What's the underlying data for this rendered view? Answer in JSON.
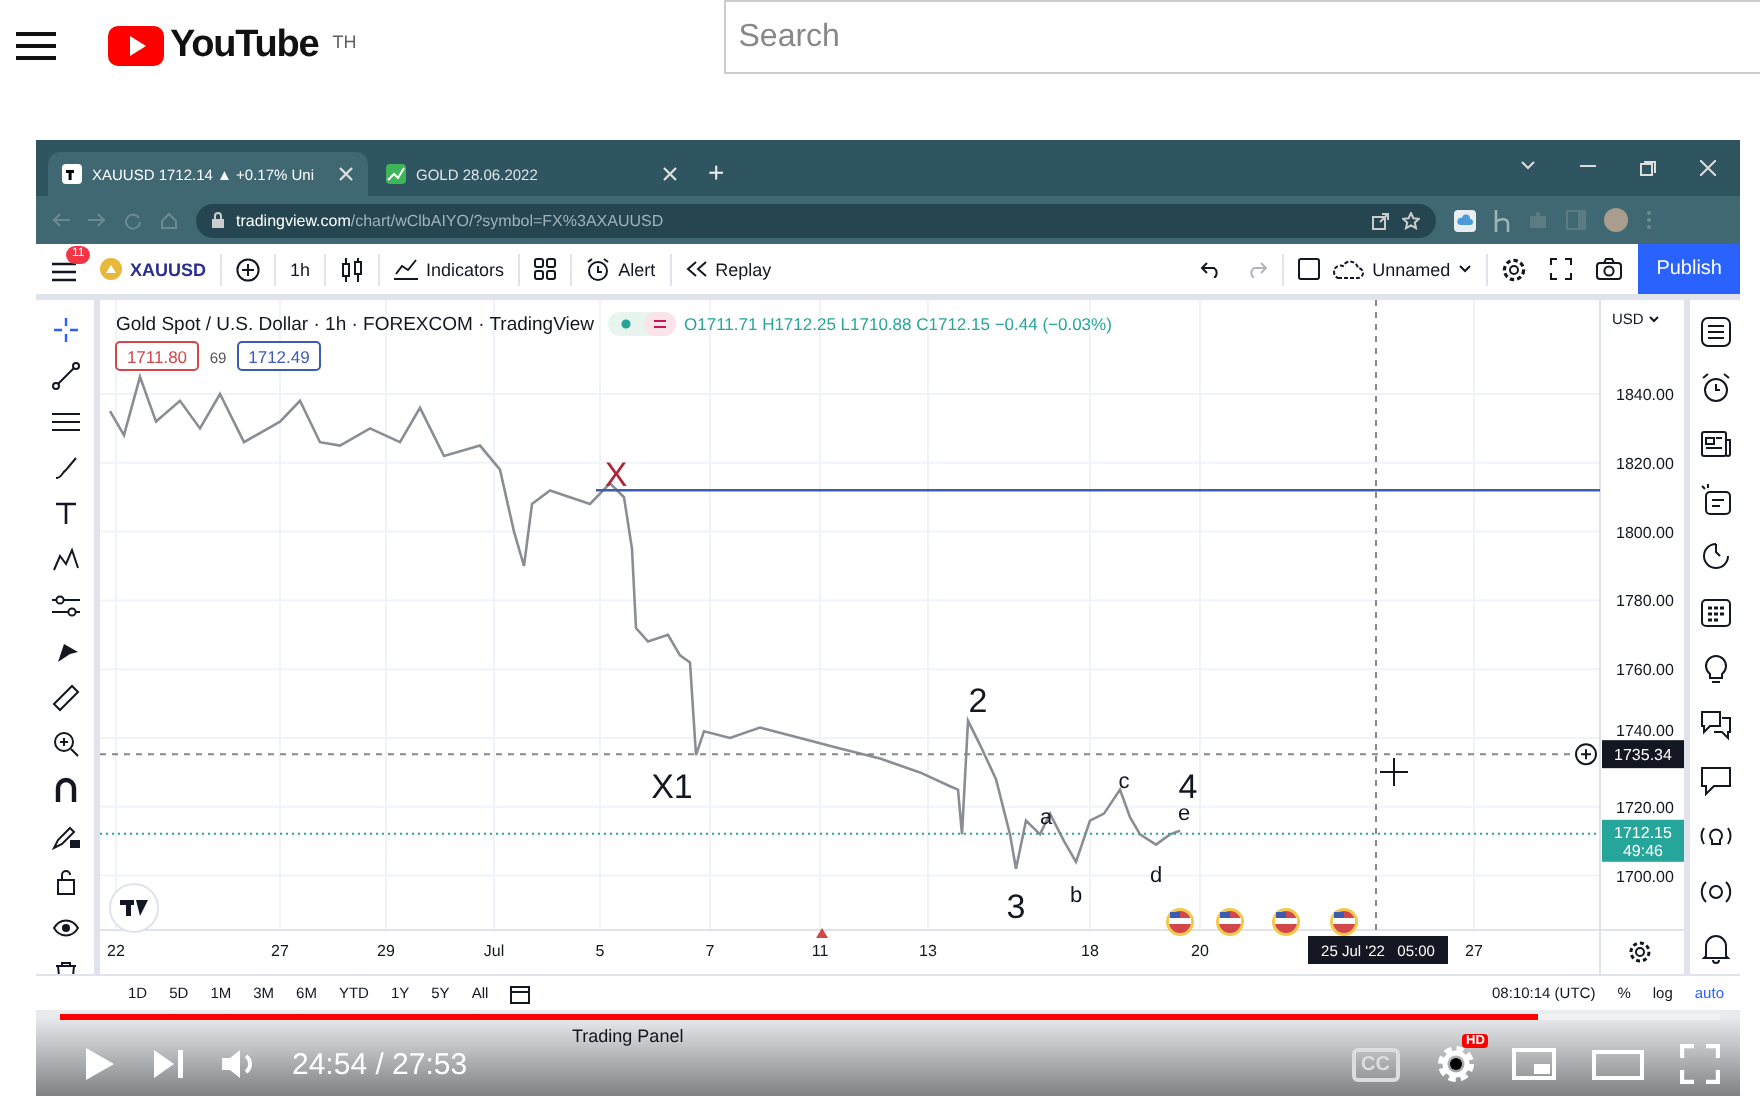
{
  "youtube": {
    "logo": "YouTube",
    "region": "TH",
    "search_placeholder": "Search"
  },
  "browser": {
    "tabs": [
      {
        "title": "XAUUSD 1712.14 ▲ +0.17% Uni",
        "selected": true
      },
      {
        "title": "GOLD 28.06.2022",
        "selected": false
      }
    ],
    "new_tab": "+",
    "address_host": "tradingview.com",
    "address_path": "/chart/wClbAIYO/?symbol=FX%3AXAUUSD"
  },
  "toolbar": {
    "badge": "11",
    "symbol": "XAUUSD",
    "interval": "1h",
    "indicators": "Indicators",
    "alert": "Alert",
    "replay": "Replay",
    "layout": "Unnamed",
    "publish": "Publish"
  },
  "chart": {
    "title": "Gold Spot / U.S. Dollar · 1h · FOREXCOM · TradingView",
    "ohlc": "O1711.71 H1712.25 L1710.88 C1712.15 −0.44 (−0.03%)",
    "bid": "1711.80",
    "spread": "69",
    "ask": "1712.49",
    "currency": "USD",
    "price_labels": [
      "1840.00",
      "1820.00",
      "1800.00",
      "1780.00",
      "1760.00",
      "1740.00",
      "1720.00",
      "1700.00"
    ],
    "crosshair_price": "1735.34",
    "last_price": "1712.15",
    "countdown": "49:46",
    "date_labels": [
      "22",
      "27",
      "29",
      "Jul",
      "5",
      "7",
      "11",
      "13",
      "18",
      "20",
      "27"
    ],
    "crosshair_date": "25 Jul '22   05:00",
    "wave_labels": [
      {
        "text": "X",
        "kind": "major",
        "color": "#b0243a"
      },
      {
        "text": "X1",
        "kind": "major",
        "color": "#131722"
      },
      {
        "text": "2",
        "kind": "major",
        "color": "#131722"
      },
      {
        "text": "3",
        "kind": "major",
        "color": "#131722"
      },
      {
        "text": "a",
        "kind": "minor",
        "color": "#131722"
      },
      {
        "text": "b",
        "kind": "minor",
        "color": "#131722"
      },
      {
        "text": "c",
        "kind": "minor",
        "color": "#131722"
      },
      {
        "text": "d",
        "kind": "minor",
        "color": "#131722"
      },
      {
        "text": "4",
        "kind": "major",
        "color": "#131722"
      },
      {
        "text": "e",
        "kind": "minor",
        "color": "#131722"
      }
    ]
  },
  "range_bar": {
    "ranges": [
      "1D",
      "5D",
      "1M",
      "3M",
      "6M",
      "YTD",
      "1Y",
      "5Y",
      "All"
    ],
    "clock": "08:10:14 (UTC)",
    "options": [
      "%",
      "log",
      "auto"
    ]
  },
  "bottom_tabs": [
    "Trading Panel"
  ],
  "player": {
    "time": "24:54 / 27:53",
    "level": 0.89,
    "captions": "CC",
    "quality_badge": "HD"
  }
}
